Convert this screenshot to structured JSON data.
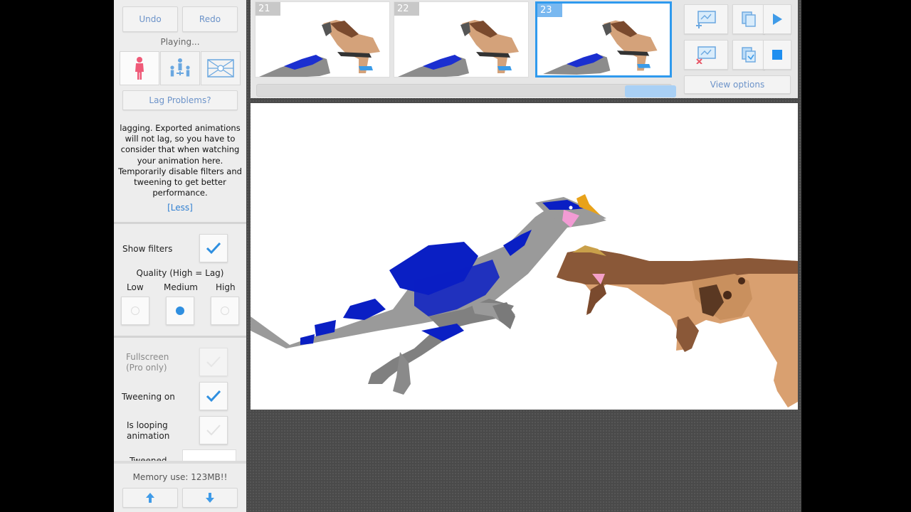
{
  "left_panel": {
    "undo_label": "Undo",
    "redo_label": "Redo",
    "status_text": "Playing...",
    "lag_button_label": "Lag Problems?",
    "lag_info_text": "lagging. Exported animations\nwill not lag, so you have to\nconsider that when watching\nyour animation here.\nTemporarily disable filters and\ntweening to get better\nperformance.",
    "less_link": "[Less]",
    "show_filters_label": "Show filters",
    "show_filters_checked": true,
    "quality_label": "Quality (High = Lag)",
    "quality_options": [
      "Low",
      "Medium",
      "High"
    ],
    "quality_selected": "Medium",
    "fullscreen_label": "Fullscreen\n(Pro only)",
    "tweening_label": "Tweening on",
    "tweening_checked": true,
    "looping_label": "Is looping\nanimation",
    "looping_checked": false,
    "tweened_label": "Tweened",
    "memory_text": "Memory use: 123MB!!"
  },
  "timeline": {
    "frames": [
      {
        "number": "21",
        "selected": false
      },
      {
        "number": "22",
        "selected": false
      },
      {
        "number": "23",
        "selected": true
      }
    ]
  },
  "toolbar": {
    "view_options_label": "View options",
    "accent_color": "#2f9aee"
  },
  "icons": {
    "mode_single": "person-icon",
    "mode_group": "group-icon",
    "mode_background": "background-icon"
  },
  "colors": {
    "raptor_body": "#9a9a9a",
    "raptor_pattern": "#0a1fc4",
    "carno_body": "#d9a070",
    "carno_back": "#8a5838"
  }
}
